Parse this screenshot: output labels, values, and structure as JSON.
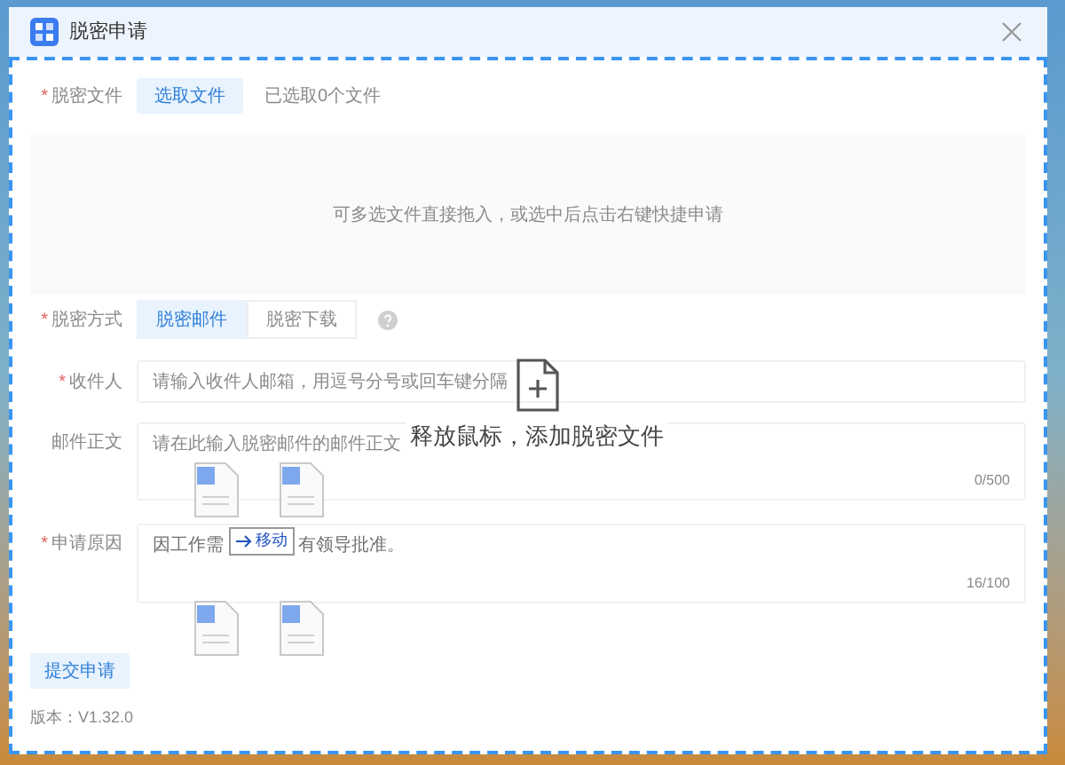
{
  "window": {
    "title": "脱密申请"
  },
  "file_row": {
    "label": "脱密文件",
    "required_mark": "*",
    "button": "选取文件",
    "status": "已选取0个文件"
  },
  "drop_area": {
    "hint": "可多选文件直接拖入，或选中后点击右键快捷申请"
  },
  "method_row": {
    "label": "脱密方式",
    "required_mark": "*",
    "options": [
      {
        "label": "脱密邮件",
        "selected": true
      },
      {
        "label": "脱密下载",
        "selected": false
      }
    ]
  },
  "recipient": {
    "label": "收件人",
    "required_mark": "*",
    "placeholder": "请输入收件人邮箱，用逗号分号或回车键分隔"
  },
  "body": {
    "label": "邮件正文",
    "placeholder": "请在此输入脱密邮件的邮件正文",
    "counter": "0/500"
  },
  "reason": {
    "label": "申请原因",
    "required_mark": "*",
    "value_visible_parts": [
      "因工作需",
      "有领导批准。"
    ],
    "counter": "16/100"
  },
  "submit": "提交申请",
  "version": "版本：V1.32.0",
  "drop_overlay": {
    "message": "释放鼠标，添加脱密文件"
  },
  "drag_badge": "移动"
}
